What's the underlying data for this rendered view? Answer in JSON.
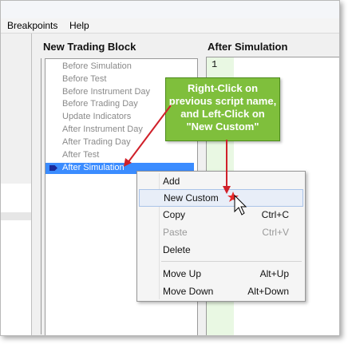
{
  "menu": {
    "items": [
      "Breakpoints",
      "Help"
    ]
  },
  "panels": {
    "left_title": "New Trading Block",
    "right_title": "After Simulation"
  },
  "script_list": [
    "Before Simulation",
    "Before Test",
    "Before Instrument Day",
    "Before Trading Day",
    "Update Indicators",
    "After Instrument Day",
    "After Trading Day",
    "After Test",
    "After Simulation"
  ],
  "selected_script": "After Simulation",
  "editor": {
    "line_number": "1"
  },
  "callout": {
    "lines": [
      "Right-Click on",
      "previous script name,",
      "and Left-Click on",
      "\"New Custom\""
    ]
  },
  "context_menu": {
    "items": [
      {
        "label": "Add",
        "shortcut": "",
        "enabled": true
      },
      {
        "label": "New Custom",
        "shortcut": "",
        "enabled": true,
        "hover": true
      },
      {
        "label": "Copy",
        "shortcut": "Ctrl+C",
        "enabled": true
      },
      {
        "label": "Paste",
        "shortcut": "Ctrl+V",
        "enabled": false
      },
      {
        "label": "Delete",
        "shortcut": "",
        "enabled": true
      },
      {
        "label": "Move Up",
        "shortcut": "Alt+Up",
        "enabled": true
      },
      {
        "label": "Move Down",
        "shortcut": "Alt+Down",
        "enabled": true
      }
    ]
  },
  "colors": {
    "selection": "#3b8cff",
    "callout_bg": "#7fbf3c",
    "arrow": "#d0202a",
    "gutter": "#e9f8e3"
  },
  "icons": [
    "selected-row-arrow-icon",
    "mouse-cursor-icon",
    "click-star-icon"
  ]
}
